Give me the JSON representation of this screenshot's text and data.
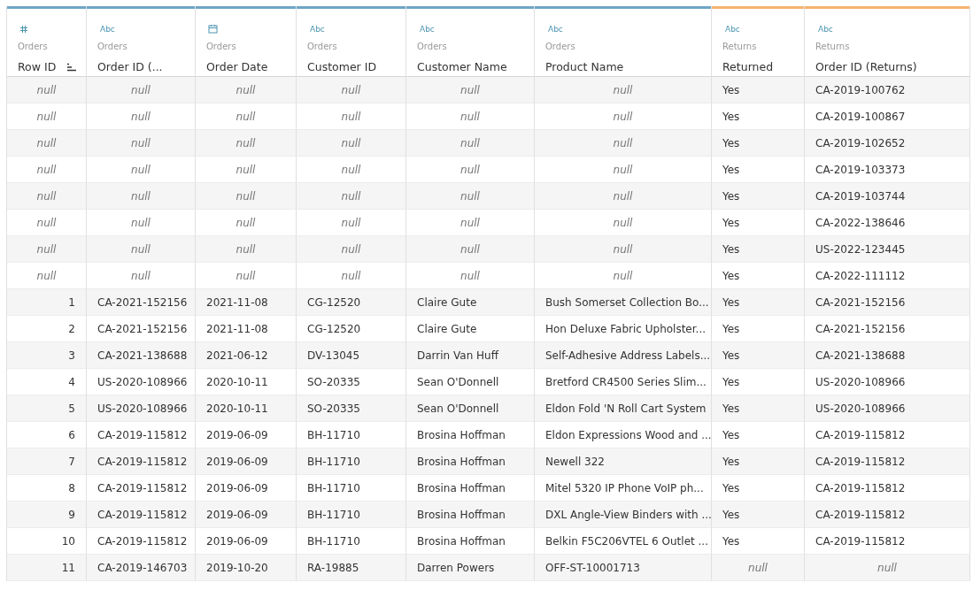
{
  "columns": [
    {
      "title": "Row ID",
      "source": "Orders",
      "color": "#6fa5c7",
      "kind": "number",
      "sorted": true
    },
    {
      "title": "Order ID (...",
      "source": "Orders",
      "color": "#6fa5c7",
      "kind": "string",
      "type_label": "Abc",
      "sorted": false
    },
    {
      "title": "Order Date",
      "source": "Orders",
      "color": "#6fa5c7",
      "kind": "date",
      "sorted": false
    },
    {
      "title": "Customer ID",
      "source": "Orders",
      "color": "#6fa5c7",
      "kind": "string",
      "type_label": "Abc",
      "sorted": false
    },
    {
      "title": "Customer Name",
      "source": "Orders",
      "color": "#6fa5c7",
      "kind": "string",
      "type_label": "Abc",
      "sorted": false
    },
    {
      "title": "Product Name",
      "source": "Orders",
      "color": "#6fa5c7",
      "kind": "string",
      "type_label": "Abc",
      "sorted": false
    },
    {
      "title": "Returned",
      "source": "Returns",
      "color": "#f5b46e",
      "kind": "string",
      "type_label": "Abc",
      "sorted": false
    },
    {
      "title": "Order ID (Returns)",
      "source": "Returns",
      "color": "#f5b46e",
      "kind": "string",
      "type_label": "Abc",
      "sorted": false
    }
  ],
  "rows": [
    {
      "cells": [
        {
          "kind": "null",
          "text": "null"
        },
        {
          "kind": "null",
          "text": "null"
        },
        {
          "kind": "null",
          "text": "null"
        },
        {
          "kind": "null",
          "text": "null"
        },
        {
          "kind": "null",
          "text": "null"
        },
        {
          "kind": "null",
          "text": "null"
        },
        "Yes",
        "CA-2019-100762"
      ]
    },
    {
      "cells": [
        {
          "kind": "null",
          "text": "null"
        },
        {
          "kind": "null",
          "text": "null"
        },
        {
          "kind": "null",
          "text": "null"
        },
        {
          "kind": "null",
          "text": "null"
        },
        {
          "kind": "null",
          "text": "null"
        },
        {
          "kind": "null",
          "text": "null"
        },
        "Yes",
        "CA-2019-100867"
      ]
    },
    {
      "cells": [
        {
          "kind": "null",
          "text": "null"
        },
        {
          "kind": "null",
          "text": "null"
        },
        {
          "kind": "null",
          "text": "null"
        },
        {
          "kind": "null",
          "text": "null"
        },
        {
          "kind": "null",
          "text": "null"
        },
        {
          "kind": "null",
          "text": "null"
        },
        "Yes",
        "CA-2019-102652"
      ]
    },
    {
      "cells": [
        {
          "kind": "null",
          "text": "null"
        },
        {
          "kind": "null",
          "text": "null"
        },
        {
          "kind": "null",
          "text": "null"
        },
        {
          "kind": "null",
          "text": "null"
        },
        {
          "kind": "null",
          "text": "null"
        },
        {
          "kind": "null",
          "text": "null"
        },
        "Yes",
        "CA-2019-103373"
      ]
    },
    {
      "cells": [
        {
          "kind": "null",
          "text": "null"
        },
        {
          "kind": "null",
          "text": "null"
        },
        {
          "kind": "null",
          "text": "null"
        },
        {
          "kind": "null",
          "text": "null"
        },
        {
          "kind": "null",
          "text": "null"
        },
        {
          "kind": "null",
          "text": "null"
        },
        "Yes",
        "CA-2019-103744"
      ]
    },
    {
      "cells": [
        {
          "kind": "null",
          "text": "null"
        },
        {
          "kind": "null",
          "text": "null"
        },
        {
          "kind": "null",
          "text": "null"
        },
        {
          "kind": "null",
          "text": "null"
        },
        {
          "kind": "null",
          "text": "null"
        },
        {
          "kind": "null",
          "text": "null"
        },
        "Yes",
        "CA-2022-138646"
      ]
    },
    {
      "cells": [
        {
          "kind": "null",
          "text": "null"
        },
        {
          "kind": "null",
          "text": "null"
        },
        {
          "kind": "null",
          "text": "null"
        },
        {
          "kind": "null",
          "text": "null"
        },
        {
          "kind": "null",
          "text": "null"
        },
        {
          "kind": "null",
          "text": "null"
        },
        "Yes",
        "US-2022-123445"
      ]
    },
    {
      "cells": [
        {
          "kind": "null",
          "text": "null"
        },
        {
          "kind": "null",
          "text": "null"
        },
        {
          "kind": "null",
          "text": "null"
        },
        {
          "kind": "null",
          "text": "null"
        },
        {
          "kind": "null",
          "text": "null"
        },
        {
          "kind": "null",
          "text": "null"
        },
        "Yes",
        "CA-2022-111112"
      ]
    },
    {
      "cells": [
        "1",
        "CA-2021-152156",
        "2021-11-08",
        "CG-12520",
        "Claire Gute",
        "Bush Somerset Collection Bo...",
        "Yes",
        "CA-2021-152156"
      ]
    },
    {
      "cells": [
        "2",
        "CA-2021-152156",
        "2021-11-08",
        "CG-12520",
        "Claire Gute",
        "Hon Deluxe Fabric Upholster...",
        "Yes",
        "CA-2021-152156"
      ]
    },
    {
      "cells": [
        "3",
        "CA-2021-138688",
        "2021-06-12",
        "DV-13045",
        "Darrin Van Huff",
        "Self-Adhesive Address Labels...",
        "Yes",
        "CA-2021-138688"
      ]
    },
    {
      "cells": [
        "4",
        "US-2020-108966",
        "2020-10-11",
        "SO-20335",
        "Sean O'Donnell",
        "Bretford CR4500 Series Slim...",
        "Yes",
        "US-2020-108966"
      ]
    },
    {
      "cells": [
        "5",
        "US-2020-108966",
        "2020-10-11",
        "SO-20335",
        "Sean O'Donnell",
        "Eldon Fold 'N Roll Cart System",
        "Yes",
        "US-2020-108966"
      ]
    },
    {
      "cells": [
        "6",
        "CA-2019-115812",
        "2019-06-09",
        "BH-11710",
        "Brosina Hoffman",
        "Eldon Expressions Wood and ...",
        "Yes",
        "CA-2019-115812"
      ]
    },
    {
      "cells": [
        "7",
        "CA-2019-115812",
        "2019-06-09",
        "BH-11710",
        "Brosina Hoffman",
        "Newell 322",
        "Yes",
        "CA-2019-115812"
      ]
    },
    {
      "cells": [
        "8",
        "CA-2019-115812",
        "2019-06-09",
        "BH-11710",
        "Brosina Hoffman",
        "Mitel 5320 IP Phone VoIP ph...",
        "Yes",
        "CA-2019-115812"
      ]
    },
    {
      "cells": [
        "9",
        "CA-2019-115812",
        "2019-06-09",
        "BH-11710",
        "Brosina Hoffman",
        "DXL Angle-View Binders with ...",
        "Yes",
        "CA-2019-115812"
      ]
    },
    {
      "cells": [
        "10",
        "CA-2019-115812",
        "2019-06-09",
        "BH-11710",
        "Brosina Hoffman",
        "Belkin F5C206VTEL 6 Outlet ...",
        "Yes",
        "CA-2019-115812"
      ]
    },
    {
      "cells": [
        "11",
        "CA-2019-146703",
        "2019-10-20",
        "RA-19885",
        "Darren Powers",
        "OFF-ST-10001713",
        {
          "kind": "null",
          "text": "null"
        },
        {
          "kind": "null",
          "text": "null"
        }
      ]
    }
  ]
}
